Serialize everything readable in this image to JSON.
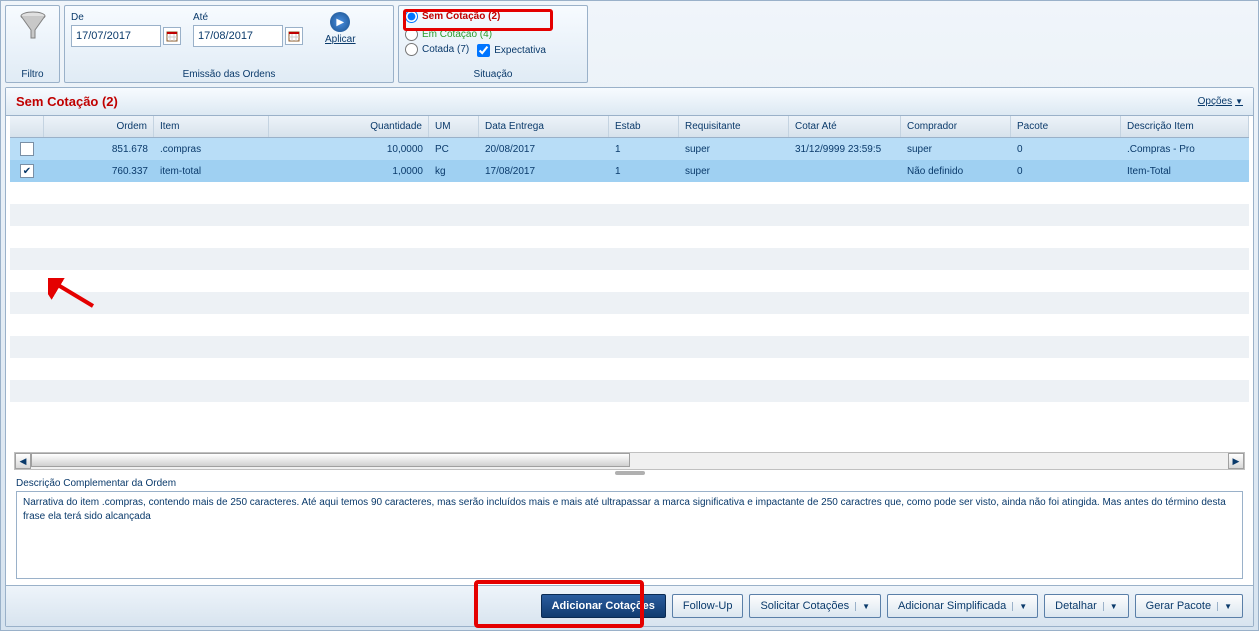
{
  "topbar": {
    "filtro_label": "Filtro",
    "emissao_label": "Emissão das Ordens",
    "de_label": "De",
    "ate_label": "Até",
    "de_value": "17/07/2017",
    "ate_value": "17/08/2017",
    "aplicar_label": "Aplicar",
    "situacao_label": "Situação",
    "sem_cotacao_label": "Sem Cotação (2)",
    "em_cotacao_label": "Em Cotação (4)",
    "cotada_label": "Cotada (7)",
    "expectativa_label": "Expectativa"
  },
  "panel": {
    "title": "Sem Cotação (2)",
    "opcoes_label": "Opções"
  },
  "grid": {
    "columns": {
      "ordem": "Ordem",
      "item": "Item",
      "quantidade": "Quantidade",
      "um": "UM",
      "data_entrega": "Data Entrega",
      "estab": "Estab",
      "requisitante": "Requisitante",
      "cotar_ate": "Cotar Até",
      "comprador": "Comprador",
      "pacote": "Pacote",
      "descricao_item": "Descrição Item"
    },
    "rows": [
      {
        "checked": false,
        "ordem": "851.678",
        "item": ".compras",
        "quantidade": "10,0000",
        "um": "PC",
        "data_entrega": "20/08/2017",
        "estab": "1",
        "requisitante": "super",
        "cotar_ate": "31/12/9999  23:59:5",
        "comprador": "super",
        "pacote": "0",
        "descricao_item": ".Compras - Pro"
      },
      {
        "checked": true,
        "ordem": "760.337",
        "item": "item-total",
        "quantidade": "1,0000",
        "um": "kg",
        "data_entrega": "17/08/2017",
        "estab": "1",
        "requisitante": "super",
        "cotar_ate": "",
        "comprador": "Não definido",
        "pacote": "0",
        "descricao_item": "Item-Total"
      }
    ]
  },
  "description": {
    "label": "Descrição Complementar da Ordem",
    "text": "Narrativa do item .compras, contendo mais de 250 caracteres. Até aqui temos 90 caracteres, mas serão incluídos mais e mais até ultrapassar a marca significativa e impactante de 250 caractres que, como pode ser visto, ainda não foi atingida. Mas antes do término desta frase ela terá sido alcançada"
  },
  "buttons": {
    "adicionar_cotacoes": "Adicionar Cotações",
    "follow_up": "Follow-Up",
    "solicitar_cotacoes": "Solicitar Cotações",
    "adicionar_simplificada": "Adicionar Simplificada",
    "detalhar": "Detalhar",
    "gerar_pacote": "Gerar Pacote"
  }
}
